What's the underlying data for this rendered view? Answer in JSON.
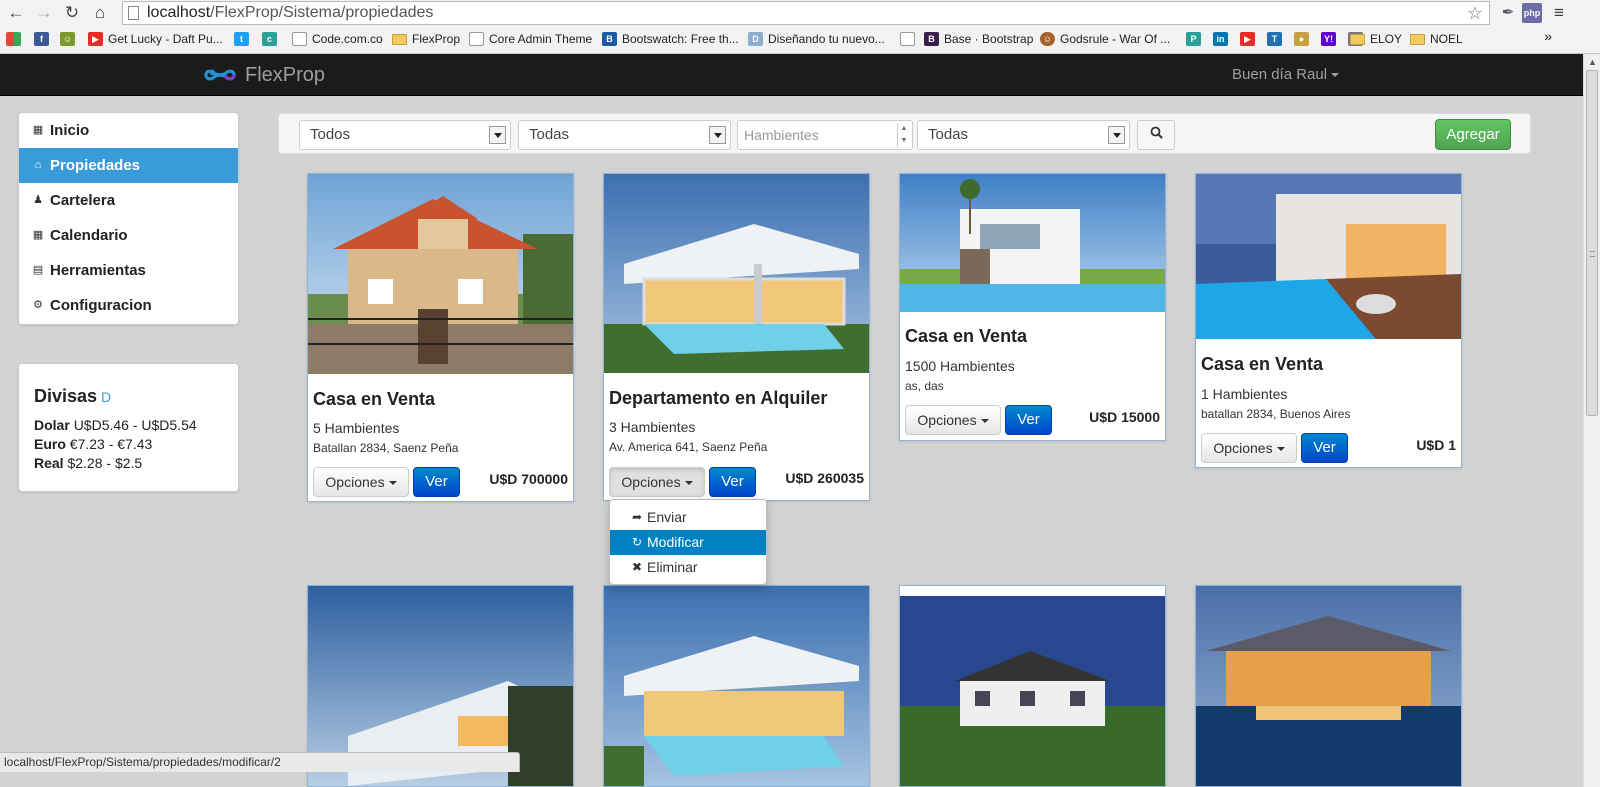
{
  "browser": {
    "url_host": "localhost",
    "url_path": "/FlexProp/Sistema/propiedades",
    "bookmarks": [
      {
        "label": "Get Lucky - Daft Pu...",
        "icon": "youtube-icon"
      },
      {
        "label": "Code.com.co",
        "icon": "page-icon"
      },
      {
        "label": "FlexProp",
        "icon": "folder-icon"
      },
      {
        "label": "Core Admin Theme",
        "icon": "page-icon"
      },
      {
        "label": "Bootswatch: Free th...",
        "icon": "bootswatch-icon"
      },
      {
        "label": "Diseñando tu nuevo...",
        "icon": "site-icon"
      },
      {
        "label": "Base · Bootstrap",
        "icon": "bootstrap-icon"
      },
      {
        "label": "Godsrule - War Of ...",
        "icon": "game-icon"
      },
      {
        "label": "ELOY",
        "icon": "folder-icon"
      },
      {
        "label": "NOEL",
        "icon": "folder-icon"
      }
    ],
    "status_url": "localhost/FlexProp/Sistema/propiedades/modificar/2"
  },
  "navbar": {
    "brand": "FlexProp",
    "user_greeting": "Buen día Raul"
  },
  "sidebar": {
    "items": [
      {
        "label": "Inicio",
        "icon": "grid-icon",
        "active": false
      },
      {
        "label": "Propiedades",
        "icon": "home-icon",
        "active": true
      },
      {
        "label": "Cartelera",
        "icon": "user-icon",
        "active": false
      },
      {
        "label": "Calendario",
        "icon": "calendar-icon",
        "active": false
      },
      {
        "label": "Herramientas",
        "icon": "list-icon",
        "active": false
      },
      {
        "label": "Configuracion",
        "icon": "cog-icon",
        "active": false
      }
    ]
  },
  "currency": {
    "title": "Divisas",
    "badge": "D",
    "rows": [
      {
        "name": "Dolar",
        "value": "U$D5.46 - U$D5.54"
      },
      {
        "name": "Euro",
        "value": "€7.23 - €7.43"
      },
      {
        "name": "Real",
        "value": "$2.28 - $2.5"
      }
    ]
  },
  "filters": {
    "operation": "Todos",
    "type": "Todas",
    "rooms_placeholder": "Hambientes",
    "city": "Todas",
    "add_label": "Agregar"
  },
  "cards": [
    {
      "title": "Casa en Venta",
      "rooms": "5 Hambientes",
      "address": "Batallan 2834, Saenz Peña",
      "price": "U$D 700000",
      "options": "Opciones",
      "view": "Ver"
    },
    {
      "title": "Departamento en Alquiler",
      "rooms": "3 Hambientes",
      "address": "Av. America 641, Saenz Peña",
      "price": "U$D 260035",
      "options": "Opciones",
      "view": "Ver"
    },
    {
      "title": "Casa en Venta",
      "rooms": "1500 Hambientes",
      "address": "as, das",
      "price": "U$D 15000",
      "options": "Opciones",
      "view": "Ver"
    },
    {
      "title": "Casa en Venta",
      "rooms": "1 Hambientes",
      "address": "batallan 2834, Buenos Aires",
      "price": "U$D 1",
      "options": "Opciones",
      "view": "Ver"
    }
  ],
  "dropdown": {
    "items": [
      {
        "label": "Enviar",
        "icon": "share-icon"
      },
      {
        "label": "Modificar",
        "icon": "refresh-icon"
      },
      {
        "label": "Eliminar",
        "icon": "remove-icon"
      }
    ]
  },
  "colors": {
    "accent": "#3a9bd9",
    "primary_button": "#0055cc",
    "success_button": "#51a351",
    "navbar": "#1b1b1b",
    "highlight": "#0081c2"
  }
}
